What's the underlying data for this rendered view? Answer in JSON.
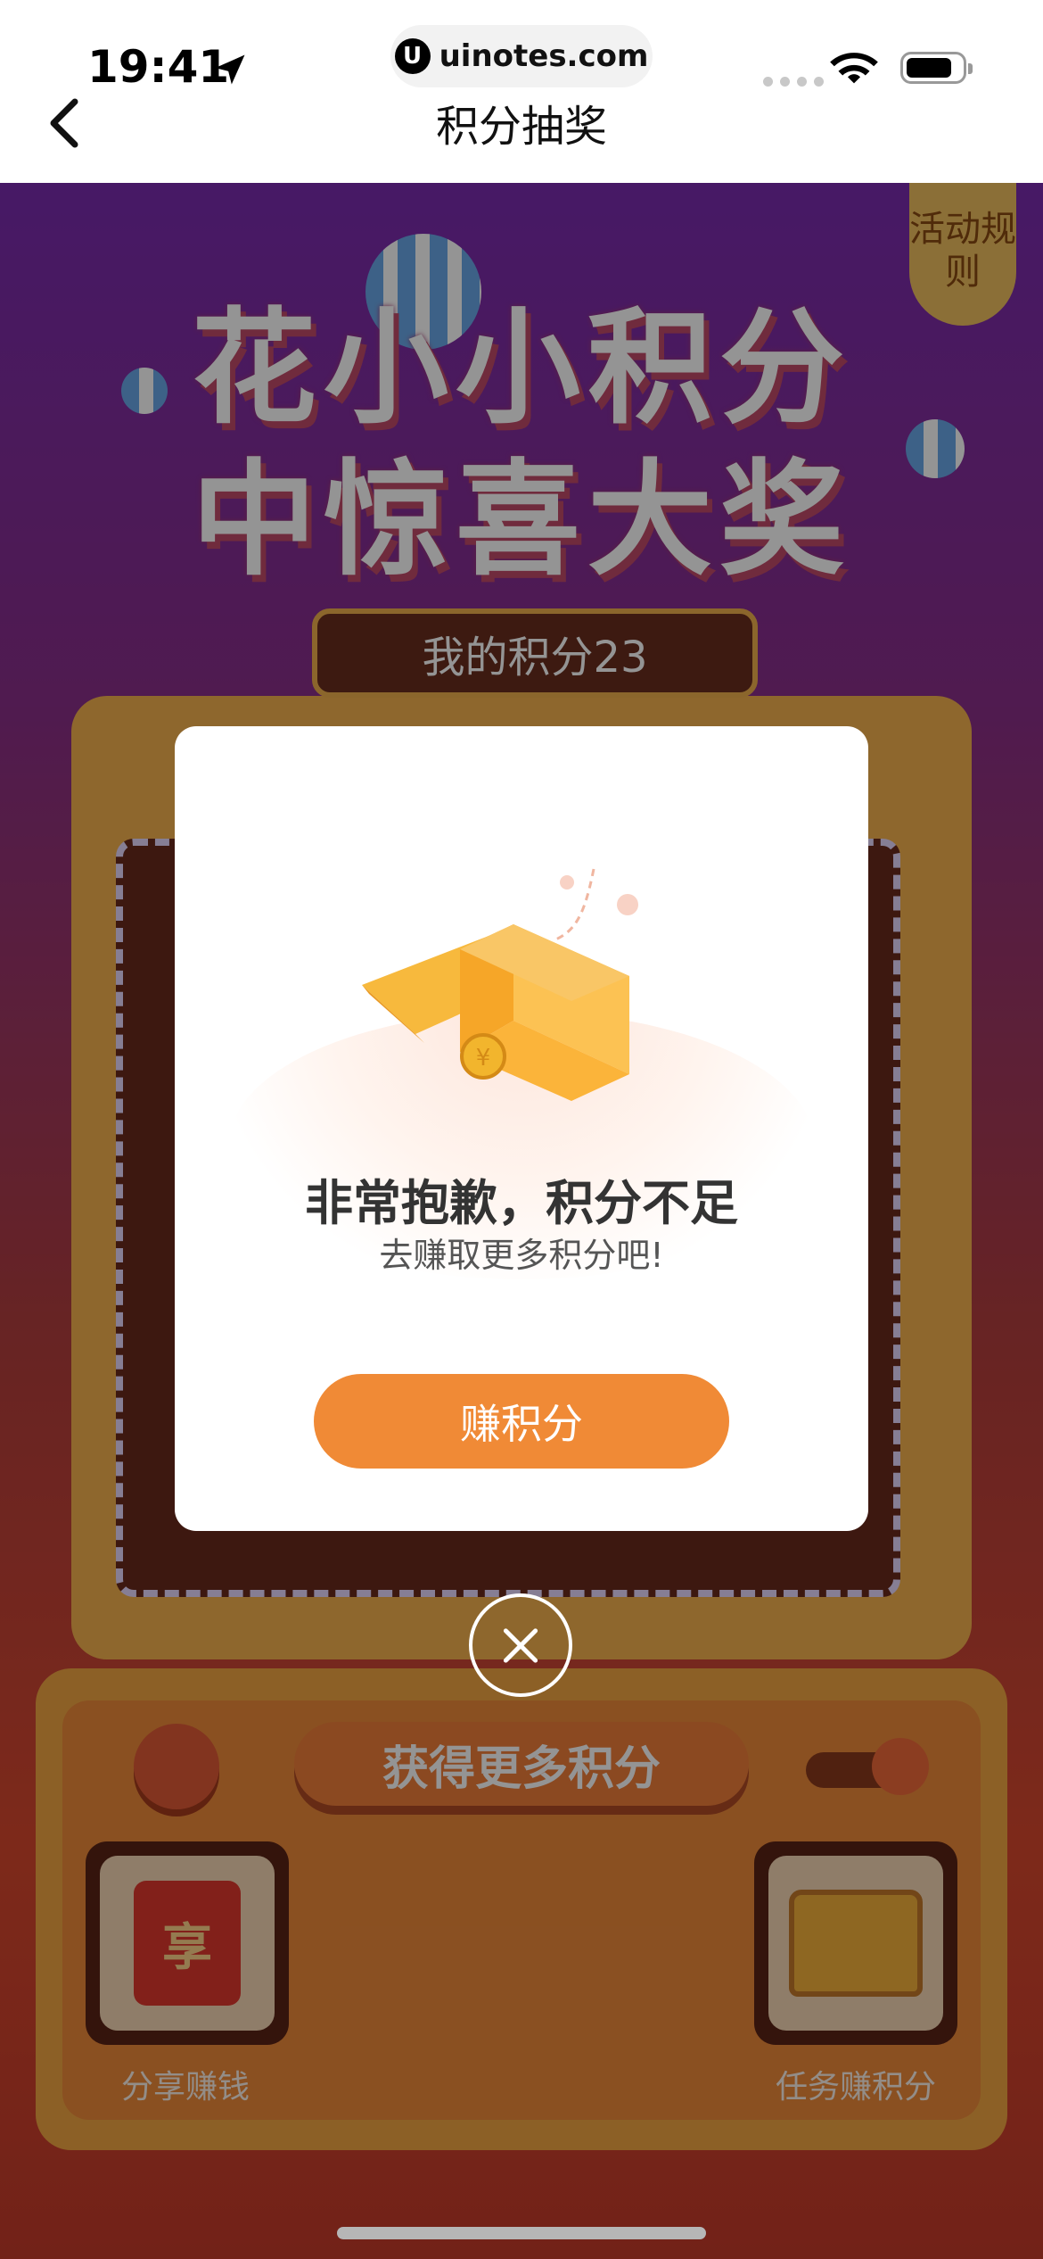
{
  "status_bar": {
    "time": "19:41",
    "url": "uinotes.com"
  },
  "nav": {
    "title": "积分抽奖"
  },
  "page": {
    "rule_tab": "活动规则",
    "hero_line1": "花小小积分",
    "hero_line2": "中惊喜大奖",
    "my_points": "我的积分23",
    "earn_more": "获得更多积分",
    "entries": [
      {
        "label": "分享赚钱",
        "icon": "red-packet-icon",
        "glyph": "享"
      },
      {
        "label": "任务赚积分",
        "icon": "treasure-chest-icon"
      }
    ]
  },
  "modal": {
    "title": "非常抱歉，积分不足",
    "subtitle": "去赚取更多积分吧!",
    "button": "赚积分",
    "icon": "open-gift-box-icon",
    "accent": "#f08a36"
  },
  "colors": {
    "accent": "#f08a36",
    "bg_top": "#7a2bb0",
    "bg_bottom": "#d8482e"
  }
}
